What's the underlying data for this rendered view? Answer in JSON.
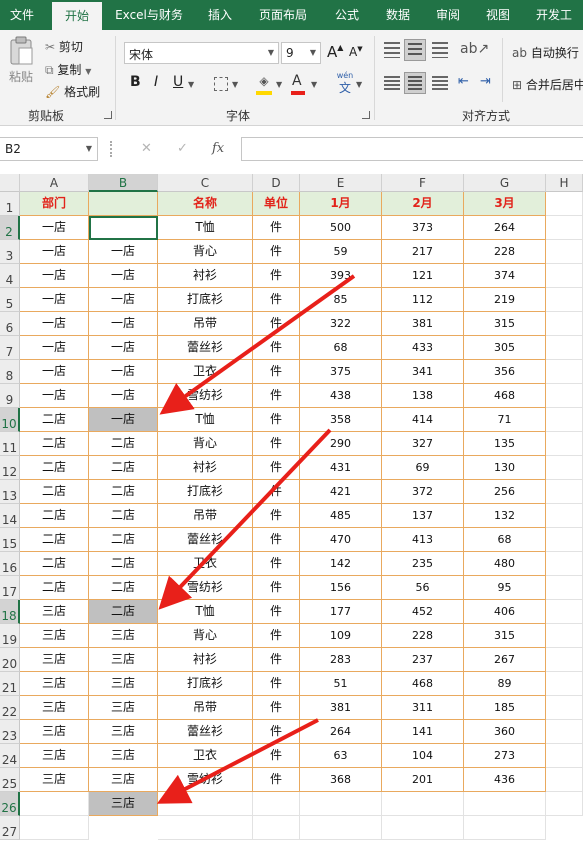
{
  "tabs": [
    "文件",
    "开始",
    "Excel与财务",
    "插入",
    "页面布局",
    "公式",
    "数据",
    "审阅",
    "视图",
    "开发工"
  ],
  "active_tab": "开始",
  "ribbon": {
    "clipboard": {
      "paste": "粘贴",
      "cut": "剪切",
      "copy": "复制",
      "format_painter": "格式刷",
      "label": "剪贴板"
    },
    "font": {
      "name": "宋体",
      "size": "9",
      "bold": "B",
      "italic": "I",
      "underline": "U",
      "grow": "A",
      "shrink": "A",
      "wen": "wén",
      "wen_char": "文",
      "label": "字体"
    },
    "alignment": {
      "wrap": "自动换行",
      "merge": "合并后居中",
      "label": "对齐方式"
    }
  },
  "formula_bar": {
    "name_box": "B2",
    "cancel": "✕",
    "enter": "✓",
    "fx": "fx",
    "value": ""
  },
  "columns": [
    "A",
    "B",
    "C",
    "D",
    "E",
    "F",
    "G",
    "H"
  ],
  "selected_column": "B",
  "row_numbers": [
    "1",
    "2",
    "3",
    "4",
    "5",
    "6",
    "7",
    "8",
    "9",
    "10",
    "11",
    "12",
    "13",
    "14",
    "15",
    "16",
    "17",
    "18",
    "19",
    "20",
    "21",
    "22",
    "23",
    "24",
    "25",
    "26",
    "27"
  ],
  "selected_rows": [
    "2",
    "10",
    "18",
    "26"
  ],
  "sheet": {
    "header": [
      "部门",
      "",
      "名称",
      "单位",
      "1月",
      "2月",
      "3月"
    ],
    "rows": [
      [
        "一店",
        "",
        "T恤",
        "件",
        "500",
        "373",
        "264"
      ],
      [
        "一店",
        "一店",
        "背心",
        "件",
        "59",
        "217",
        "228"
      ],
      [
        "一店",
        "一店",
        "衬衫",
        "件",
        "393",
        "121",
        "374"
      ],
      [
        "一店",
        "一店",
        "打底衫",
        "件",
        "85",
        "112",
        "219"
      ],
      [
        "一店",
        "一店",
        "吊带",
        "件",
        "322",
        "381",
        "315"
      ],
      [
        "一店",
        "一店",
        "蕾丝衫",
        "件",
        "68",
        "433",
        "305"
      ],
      [
        "一店",
        "一店",
        "卫衣",
        "件",
        "375",
        "341",
        "356"
      ],
      [
        "一店",
        "一店",
        "雪纺衫",
        "件",
        "438",
        "138",
        "468"
      ],
      [
        "二店",
        "一店",
        "T恤",
        "件",
        "358",
        "414",
        "71"
      ],
      [
        "二店",
        "二店",
        "背心",
        "件",
        "290",
        "327",
        "135"
      ],
      [
        "二店",
        "二店",
        "衬衫",
        "件",
        "431",
        "69",
        "130"
      ],
      [
        "二店",
        "二店",
        "打底衫",
        "件",
        "421",
        "372",
        "256"
      ],
      [
        "二店",
        "二店",
        "吊带",
        "件",
        "485",
        "137",
        "132"
      ],
      [
        "二店",
        "二店",
        "蕾丝衫",
        "件",
        "470",
        "413",
        "68"
      ],
      [
        "二店",
        "二店",
        "卫衣",
        "件",
        "142",
        "235",
        "480"
      ],
      [
        "二店",
        "二店",
        "雪纺衫",
        "件",
        "156",
        "56",
        "95"
      ],
      [
        "三店",
        "二店",
        "T恤",
        "件",
        "177",
        "452",
        "406"
      ],
      [
        "三店",
        "三店",
        "背心",
        "件",
        "109",
        "228",
        "315"
      ],
      [
        "三店",
        "三店",
        "衬衫",
        "件",
        "283",
        "237",
        "267"
      ],
      [
        "三店",
        "三店",
        "打底衫",
        "件",
        "51",
        "468",
        "89"
      ],
      [
        "三店",
        "三店",
        "吊带",
        "件",
        "381",
        "311",
        "185"
      ],
      [
        "三店",
        "三店",
        "蕾丝衫",
        "件",
        "264",
        "141",
        "360"
      ],
      [
        "三店",
        "三店",
        "卫衣",
        "件",
        "63",
        "104",
        "273"
      ],
      [
        "三店",
        "三店",
        "雪纺衫",
        "件",
        "368",
        "201",
        "436"
      ]
    ],
    "extra_b_cell": "三店",
    "gray_rows": [
      10,
      18,
      26
    ],
    "active_cell": "B2"
  },
  "colors": {
    "accent": "#217346",
    "header_fill": "#e2efda",
    "header_text": "#e2231a",
    "border": "#e9a95e",
    "gray_cell": "#c0c0c0",
    "arrow": "#e8201a"
  }
}
